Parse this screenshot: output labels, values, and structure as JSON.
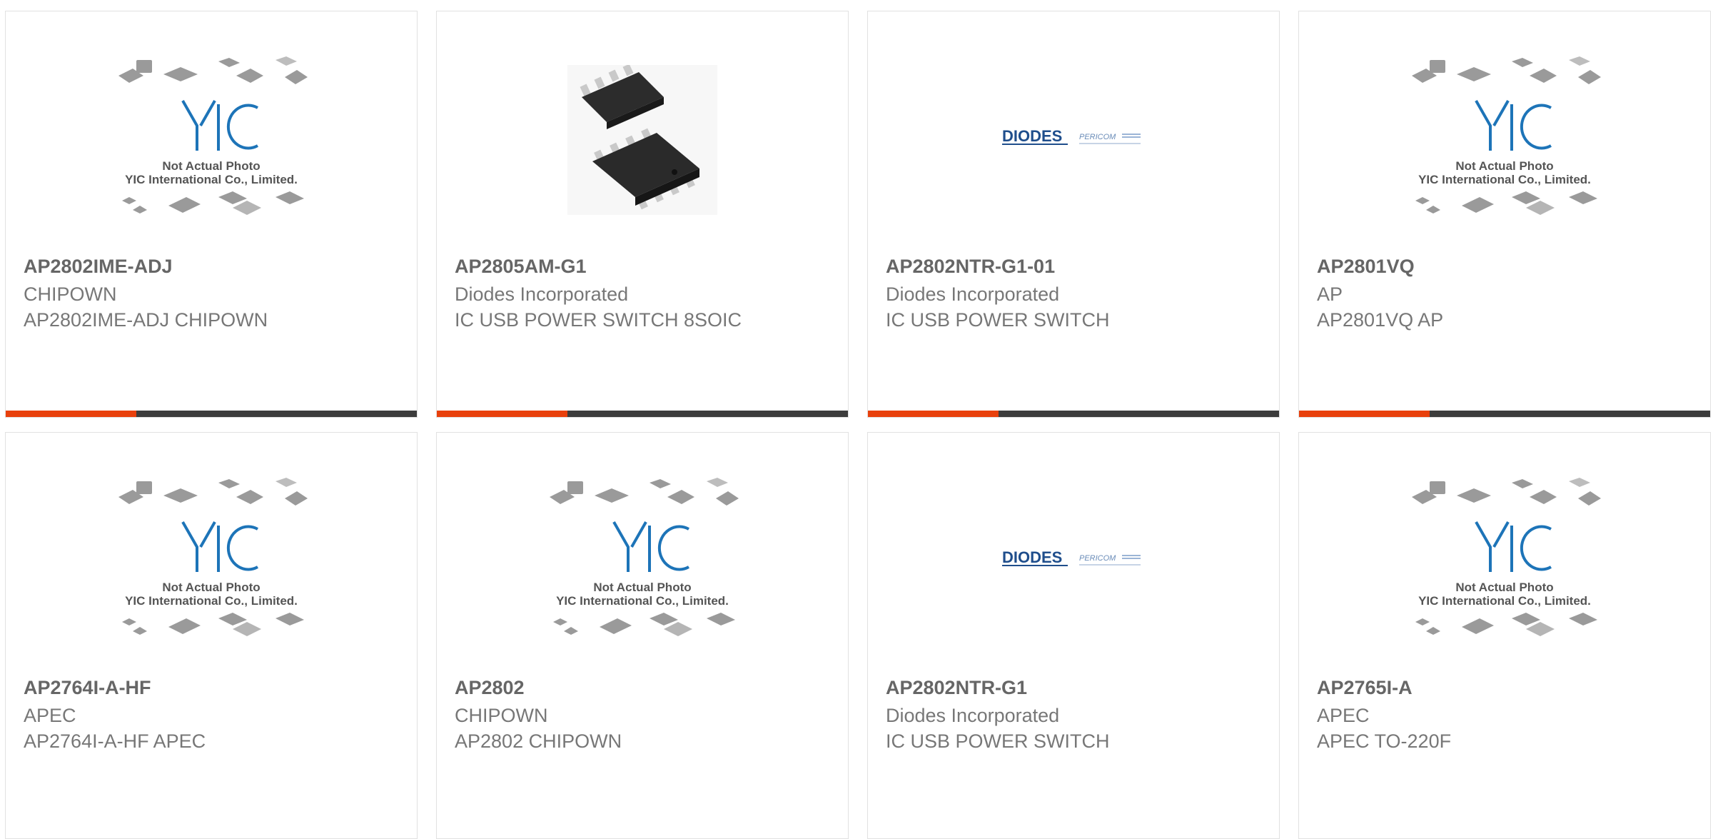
{
  "products": [
    {
      "part": "AP2802IME-ADJ",
      "manufacturer": "CHIPOWN",
      "description": "AP2802IME-ADJ CHIPOWN",
      "image": "yic-placeholder"
    },
    {
      "part": "AP2805AM-G1",
      "manufacturer": "Diodes Incorporated",
      "description": "IC USB POWER SWITCH 8SOIC",
      "image": "soic8-photo"
    },
    {
      "part": "AP2802NTR-G1-01",
      "manufacturer": "Diodes Incorporated",
      "description": "IC USB POWER SWITCH",
      "image": "diodes-pericom-logo"
    },
    {
      "part": "AP2801VQ",
      "manufacturer": "AP",
      "description": "AP2801VQ AP",
      "image": "yic-placeholder"
    },
    {
      "part": "AP2764I-A-HF",
      "manufacturer": "APEC",
      "description": "AP2764I-A-HF APEC",
      "image": "yic-placeholder"
    },
    {
      "part": "AP2802",
      "manufacturer": "CHIPOWN",
      "description": "AP2802 CHIPOWN",
      "image": "yic-placeholder"
    },
    {
      "part": "AP2802NTR-G1",
      "manufacturer": "Diodes Incorporated",
      "description": "IC USB POWER SWITCH",
      "image": "diodes-pericom-logo"
    },
    {
      "part": "AP2765I-A",
      "manufacturer": "APEC",
      "description": "APEC TO-220F",
      "image": "yic-placeholder"
    }
  ],
  "placeholder": {
    "logo_text": "YIC",
    "line1": "Not Actual Photo",
    "line2": "YIC International Co., Limited."
  },
  "logos": {
    "diodes": "DIODES",
    "pericom": "PERICOM"
  },
  "colors": {
    "accent": "#e8400c",
    "bar": "#3c3c3c",
    "border": "#e1e1e1",
    "yic_blue": "#1d74b8"
  }
}
